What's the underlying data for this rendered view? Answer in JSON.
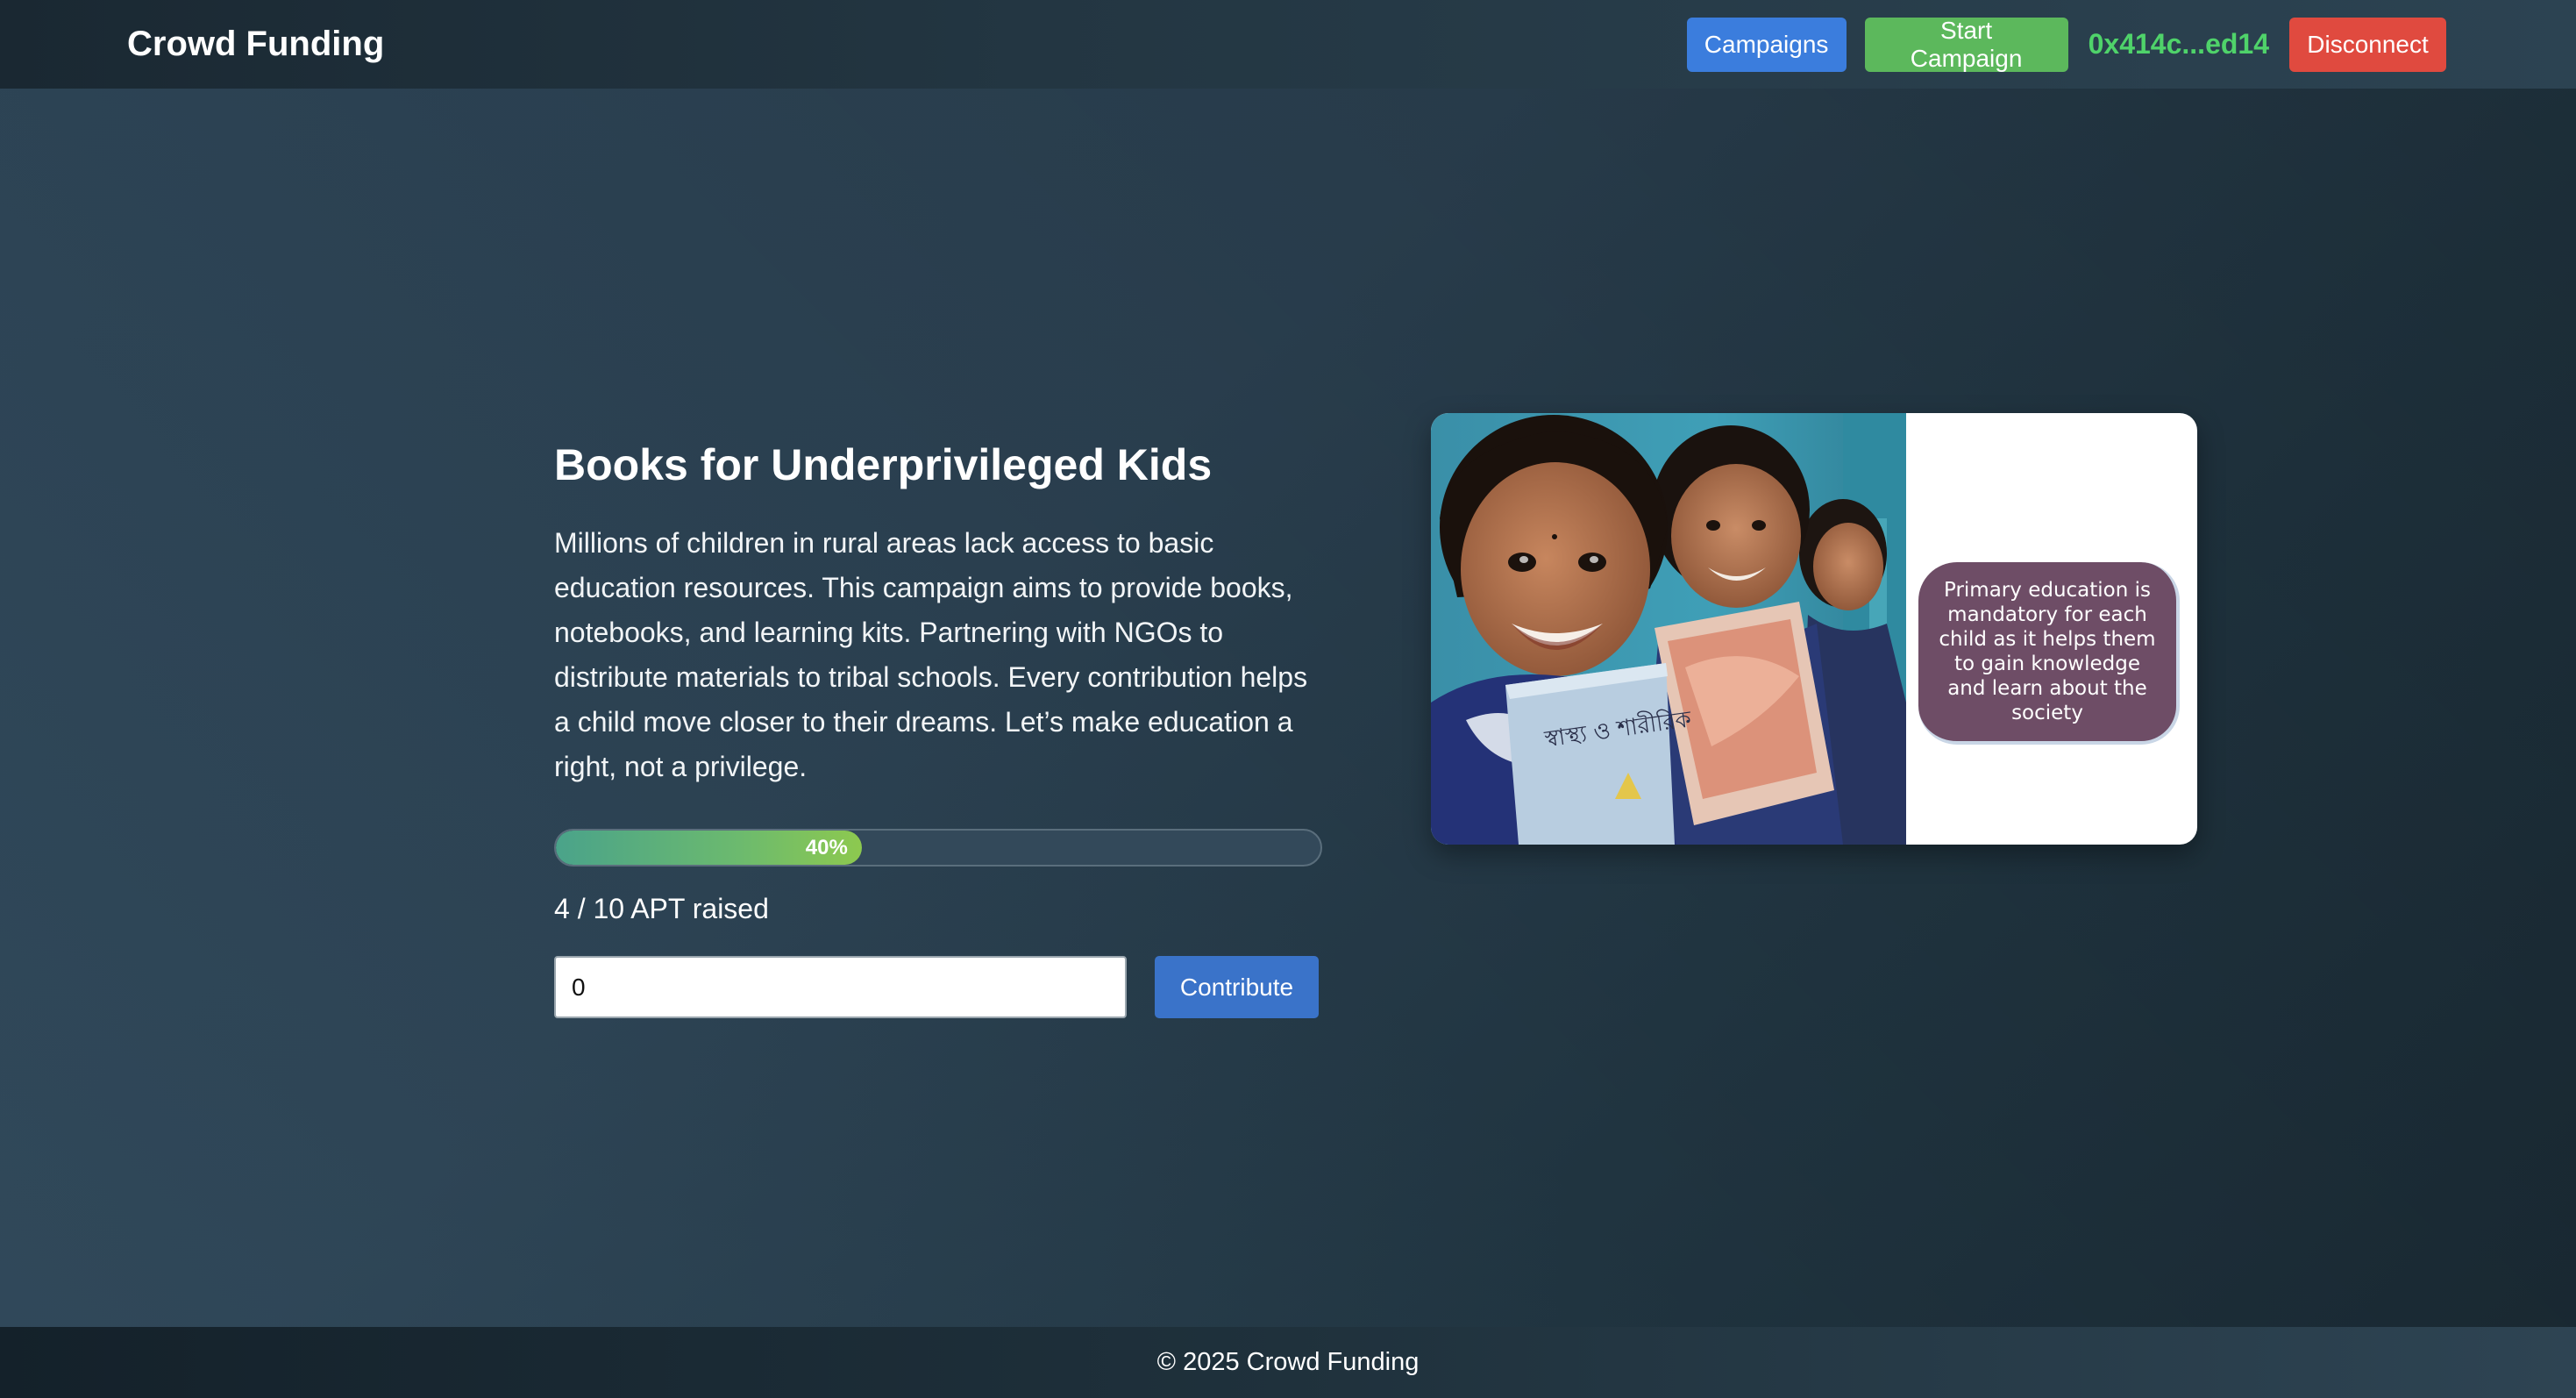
{
  "navbar": {
    "brand": "Crowd Funding",
    "campaigns_label": "Campaigns",
    "start_campaign_label": "Start Campaign",
    "wallet_address": "0x414c...ed14",
    "disconnect_label": "Disconnect"
  },
  "campaign": {
    "title": "Books for Underprivileged Kids",
    "description": "Millions of children in rural areas lack access to basic education resources. This campaign aims to provide books, notebooks, and learning kits. Partnering with NGOs to distribute materials to tribal schools. Every contribution helps a child move closer to their dreams. Let’s make education a right, not a privilege.",
    "progress_fraction": 0.4,
    "progress_label": "40%",
    "raised_text": "4 / 10 APT raised",
    "amount_value": "0",
    "contribute_label": "Contribute",
    "image": {
      "book_text": "স্বাস্থ্য ও শারীরিক",
      "bubble_text": "Primary education is mandatory for each child as it helps them to gain knowledge and learn about the society"
    }
  },
  "footer": {
    "text": "© 2025 Crowd Funding"
  },
  "colors": {
    "campaigns_button": "#3b7ddd",
    "start_campaign_button": "#5cb85c",
    "disconnect_button": "#e04a3f",
    "wallet_text": "#4fd36a",
    "contribute_button": "#3a73c9",
    "bubble": "#6e4d66"
  }
}
